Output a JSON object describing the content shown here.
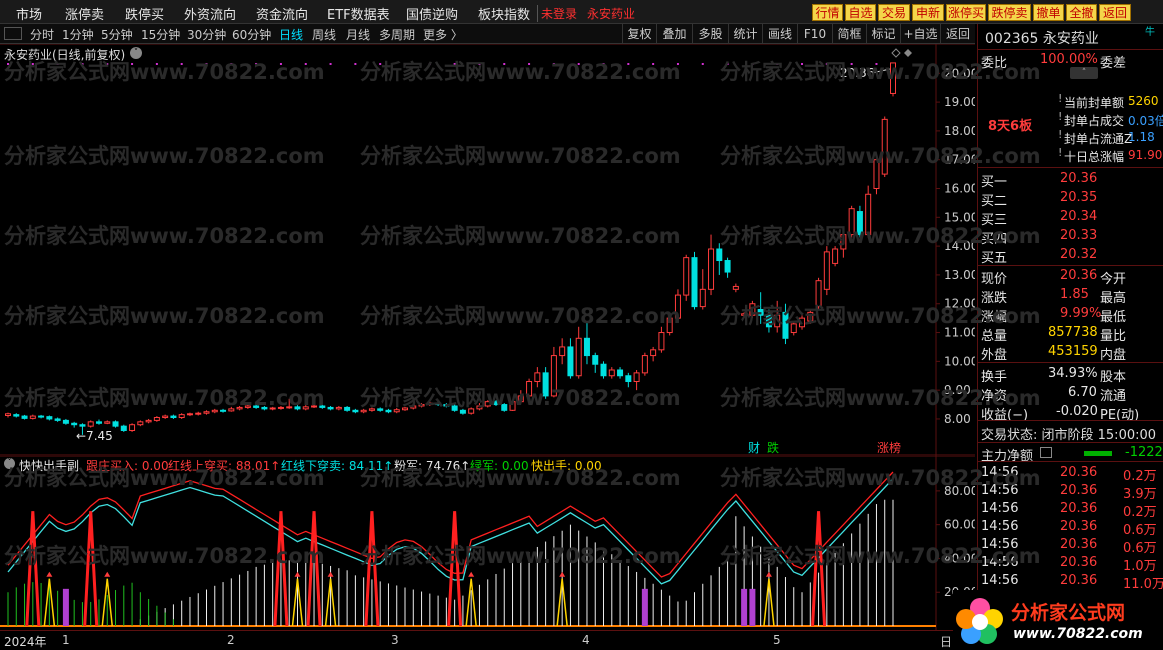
{
  "menu": [
    "市场",
    "涨停卖",
    "跌停买",
    "外资流向",
    "资金流向",
    "ETF数据表",
    "国债逆购",
    "板块指数"
  ],
  "menu_status": "未登录",
  "menu_stock": "永安药业",
  "right_buttons": [
    "行情",
    "自选",
    "交易",
    "申新",
    "涨停买",
    "跌停卖",
    "撤单",
    "全撤",
    "返回"
  ],
  "periods": [
    "分时",
    "1分钟",
    "5分钟",
    "15分钟",
    "30分钟",
    "60分钟",
    "日线",
    "周线",
    "月线",
    "多周期",
    "更多 〉"
  ],
  "active_period": "日线",
  "tools": [
    "复权",
    "叠加",
    "多股",
    "统计",
    "画线",
    "F10",
    "简框",
    "标记",
    "+自选",
    "返回"
  ],
  "chart_title": "永安药业(日线,前复权)",
  "watermark": "分析家公式网www.70822.com",
  "main_price_labels": [
    "20.00",
    "19.00",
    "18.00",
    "17.00",
    "16.00",
    "15.00",
    "14.00",
    "13.00",
    "12.00",
    "11.00",
    "10.00",
    "9.00",
    "8.00"
  ],
  "high_label": "20.36",
  "low_label": "←7.45",
  "event_labels": {
    "cai": "财",
    "die": "跌",
    "zhangbang": "涨榜"
  },
  "indicator": {
    "title": "快快出手副",
    "genzhuang": "跟庄买入: 0.00",
    "hongxian": "红线上穿买: 88.01↑",
    "lanxian": "红线下穿卖: 84.11↑",
    "fenjun": "粉军: 74.76↑",
    "lvjun": "绿军: 0.00",
    "kuaichushou": "快出手: 0.00"
  },
  "indicator_labels": [
    "80.00",
    "60.00",
    "40.00",
    "20.00"
  ],
  "xaxis": {
    "year": "2024年",
    "months": [
      "1",
      "2",
      "3",
      "4",
      "5"
    ],
    "right": "日"
  },
  "stock": {
    "code_name": "002365 永安药业",
    "weibi_label": "委比",
    "weibi": "100.00%",
    "weicha_label": "委差",
    "streak": "8天6板",
    "seal": [
      {
        "label": "当前封单额",
        "value": "5260"
      },
      {
        "label": "封单占成交",
        "value": "0.03倍"
      },
      {
        "label": "封单占流通Z",
        "value": "1.18"
      },
      {
        "label": "十日总涨幅",
        "value": "91.90"
      }
    ],
    "niuban": "牛",
    "buys": [
      {
        "label": "买一",
        "price": "20.36"
      },
      {
        "label": "买二",
        "price": "20.35"
      },
      {
        "label": "买三",
        "price": "20.34"
      },
      {
        "label": "买四",
        "price": "20.33"
      },
      {
        "label": "买五",
        "price": "20.32"
      }
    ],
    "quote": [
      {
        "l": "现价",
        "v": "20.36",
        "r": "今开"
      },
      {
        "l": "涨跌",
        "v": "1.85",
        "r": "最高"
      },
      {
        "l": "涨幅",
        "v": "9.99%",
        "r": "最低"
      },
      {
        "l": "总量",
        "v": "857738",
        "r": "量比"
      },
      {
        "l": "外盘",
        "v": "453159",
        "r": "内盘"
      }
    ],
    "quote2": [
      {
        "l": "换手",
        "v": "34.93%",
        "r": "股本"
      },
      {
        "l": "净资",
        "v": "6.70",
        "r": "流通"
      },
      {
        "l": "收益(−)",
        "v": "-0.020",
        "r": "PE(动)"
      }
    ],
    "trade_state": "交易状态: 闭市阶段 15:00:00",
    "main_net_label": "主力净额",
    "main_net_value": "-1222",
    "ticks": [
      {
        "t": "14:56",
        "p": "20.36",
        "v": "0.2万"
      },
      {
        "t": "14:56",
        "p": "20.36",
        "v": "3.9万"
      },
      {
        "t": "14:56",
        "p": "20.36",
        "v": "0.2万"
      },
      {
        "t": "14:56",
        "p": "20.36",
        "v": "0.6万"
      },
      {
        "t": "14:56",
        "p": "20.36",
        "v": "0.6万"
      },
      {
        "t": "14:56",
        "p": "20.36",
        "v": "1.0万"
      },
      {
        "t": "14:56",
        "p": "20.36",
        "v": "11.0万"
      }
    ]
  },
  "logo": {
    "name": "分析家公式网",
    "url": "www.70822.com"
  },
  "chart_data": {
    "type": "candlestick",
    "ylim": [
      7.2,
      20.6
    ],
    "candles": [
      [
        8.12,
        8.18,
        8.05,
        8.22
      ],
      [
        8.15,
        8.1,
        8.05,
        8.2
      ],
      [
        8.1,
        8.02,
        7.98,
        8.14
      ],
      [
        8.02,
        8.1,
        7.98,
        8.15
      ],
      [
        8.1,
        8.08,
        8.02,
        8.14
      ],
      [
        8.08,
        8.0,
        7.95,
        8.12
      ],
      [
        8.0,
        7.95,
        7.9,
        8.05
      ],
      [
        7.95,
        7.85,
        7.8,
        8.0
      ],
      [
        7.85,
        7.8,
        7.7,
        7.9
      ],
      [
        7.8,
        7.75,
        7.45,
        7.85
      ],
      [
        7.75,
        7.9,
        7.7,
        7.95
      ],
      [
        7.9,
        7.85,
        7.8,
        7.98
      ],
      [
        7.85,
        7.9,
        7.82,
        7.95
      ],
      [
        7.9,
        7.75,
        7.7,
        7.95
      ],
      [
        7.75,
        7.6,
        7.55,
        7.8
      ],
      [
        7.6,
        7.8,
        7.55,
        7.85
      ],
      [
        7.8,
        7.9,
        7.75,
        7.95
      ],
      [
        7.9,
        7.95,
        7.85,
        8.0
      ],
      [
        7.95,
        8.05,
        7.9,
        8.1
      ],
      [
        8.05,
        8.1,
        8.0,
        8.15
      ],
      [
        8.1,
        8.05,
        8.0,
        8.15
      ],
      [
        8.05,
        8.15,
        8.0,
        8.2
      ],
      [
        8.15,
        8.18,
        8.1,
        8.22
      ],
      [
        8.18,
        8.2,
        8.12,
        8.25
      ],
      [
        8.2,
        8.25,
        8.15,
        8.3
      ],
      [
        8.25,
        8.3,
        8.2,
        8.35
      ],
      [
        8.3,
        8.28,
        8.22,
        8.35
      ],
      [
        8.28,
        8.35,
        8.25,
        8.42
      ],
      [
        8.35,
        8.4,
        8.3,
        8.45
      ],
      [
        8.4,
        8.45,
        8.35,
        8.5
      ],
      [
        8.45,
        8.4,
        8.35,
        8.5
      ],
      [
        8.4,
        8.35,
        8.3,
        8.45
      ],
      [
        8.35,
        8.38,
        8.3,
        8.42
      ],
      [
        8.38,
        8.4,
        8.32,
        8.45
      ],
      [
        8.4,
        8.42,
        8.35,
        8.7
      ],
      [
        8.42,
        8.35,
        8.3,
        8.48
      ],
      [
        8.35,
        8.42,
        8.3,
        8.48
      ],
      [
        8.42,
        8.45,
        8.38,
        8.5
      ],
      [
        8.45,
        8.4,
        8.35,
        8.5
      ],
      [
        8.4,
        8.35,
        8.3,
        8.45
      ],
      [
        8.35,
        8.4,
        8.3,
        8.45
      ],
      [
        8.4,
        8.3,
        8.25,
        8.45
      ],
      [
        8.3,
        8.25,
        8.2,
        8.35
      ],
      [
        8.25,
        8.3,
        8.2,
        8.35
      ],
      [
        8.3,
        8.35,
        8.25,
        8.4
      ],
      [
        8.35,
        8.3,
        8.25,
        8.4
      ],
      [
        8.3,
        8.25,
        8.2,
        8.35
      ],
      [
        8.25,
        8.32,
        8.2,
        8.38
      ],
      [
        8.32,
        8.38,
        8.28,
        8.42
      ],
      [
        8.38,
        8.45,
        8.33,
        8.5
      ],
      [
        8.45,
        8.5,
        8.4,
        8.55
      ],
      [
        8.5,
        8.55,
        8.45,
        8.6
      ],
      [
        8.55,
        8.5,
        8.45,
        8.6
      ],
      [
        8.5,
        8.45,
        8.4,
        8.55
      ],
      [
        8.45,
        8.3,
        8.25,
        8.5
      ],
      [
        8.3,
        8.2,
        8.15,
        8.35
      ],
      [
        8.2,
        8.35,
        8.15,
        8.4
      ],
      [
        8.35,
        8.45,
        8.3,
        8.55
      ],
      [
        8.45,
        8.6,
        8.4,
        8.65
      ],
      [
        8.6,
        8.5,
        8.45,
        8.65
      ],
      [
        8.5,
        8.3,
        8.25,
        8.55
      ],
      [
        8.3,
        8.6,
        8.28,
        8.65
      ],
      [
        8.6,
        8.8,
        8.55,
        9.0
      ],
      [
        8.8,
        9.3,
        8.75,
        9.4
      ],
      [
        9.3,
        9.6,
        9.1,
        9.8
      ],
      [
        9.6,
        8.8,
        8.7,
        9.8
      ],
      [
        8.8,
        10.2,
        8.75,
        10.5
      ],
      [
        10.2,
        10.5,
        9.9,
        10.8
      ],
      [
        10.5,
        9.5,
        9.4,
        10.8
      ],
      [
        9.5,
        10.8,
        9.4,
        11.2
      ],
      [
        10.8,
        10.2,
        9.9,
        11.4
      ],
      [
        10.2,
        9.9,
        9.6,
        10.3
      ],
      [
        9.9,
        9.5,
        9.4,
        10.0
      ],
      [
        9.5,
        9.7,
        9.4,
        9.8
      ],
      [
        9.7,
        9.5,
        9.4,
        9.8
      ],
      [
        9.5,
        9.3,
        9.1,
        9.6
      ],
      [
        9.3,
        9.6,
        9.0,
        9.7
      ],
      [
        9.6,
        10.2,
        9.5,
        10.3
      ],
      [
        10.2,
        10.4,
        10.0,
        10.5
      ],
      [
        10.4,
        11.0,
        10.3,
        11.2
      ],
      [
        11.0,
        11.5,
        10.9,
        11.6
      ],
      [
        11.5,
        12.3,
        11.4,
        12.5
      ],
      [
        12.3,
        13.6,
        12.1,
        13.7
      ],
      [
        13.6,
        11.9,
        11.8,
        13.8
      ],
      [
        11.9,
        12.5,
        11.8,
        13.2
      ],
      [
        12.5,
        13.9,
        12.3,
        14.4
      ],
      [
        13.9,
        13.5,
        13.0,
        14.1
      ],
      [
        13.5,
        13.1,
        12.9,
        13.6
      ],
      [
        12.5,
        12.6,
        12.4,
        12.7
      ],
      [
        11.6,
        11.65,
        11.5,
        11.7
      ],
      [
        11.6,
        12.0,
        11.5,
        12.1
      ],
      [
        11.8,
        11.6,
        11.3,
        12.4
      ],
      [
        11.6,
        11.2,
        11.0,
        11.8
      ],
      [
        11.2,
        11.6,
        11.0,
        12.1
      ],
      [
        11.7,
        10.8,
        10.6,
        12.0
      ],
      [
        11.0,
        11.3,
        10.9,
        11.4
      ],
      [
        11.2,
        11.5,
        11.1,
        11.6
      ],
      [
        11.4,
        11.7,
        11.3,
        11.8
      ],
      [
        11.9,
        12.8,
        11.8,
        12.9
      ],
      [
        12.5,
        13.8,
        12.3,
        14.0
      ],
      [
        13.4,
        13.9,
        13.3,
        14.0
      ],
      [
        13.9,
        14.4,
        13.6,
        14.6
      ],
      [
        14.4,
        15.3,
        14.3,
        15.4
      ],
      [
        15.2,
        14.4,
        14.3,
        15.4
      ],
      [
        14.4,
        15.8,
        14.3,
        16.1
      ],
      [
        16.0,
        17.0,
        15.8,
        17.1
      ],
      [
        16.5,
        18.4,
        16.4,
        18.5
      ],
      [
        19.3,
        20.36,
        19.2,
        20.36
      ]
    ]
  }
}
